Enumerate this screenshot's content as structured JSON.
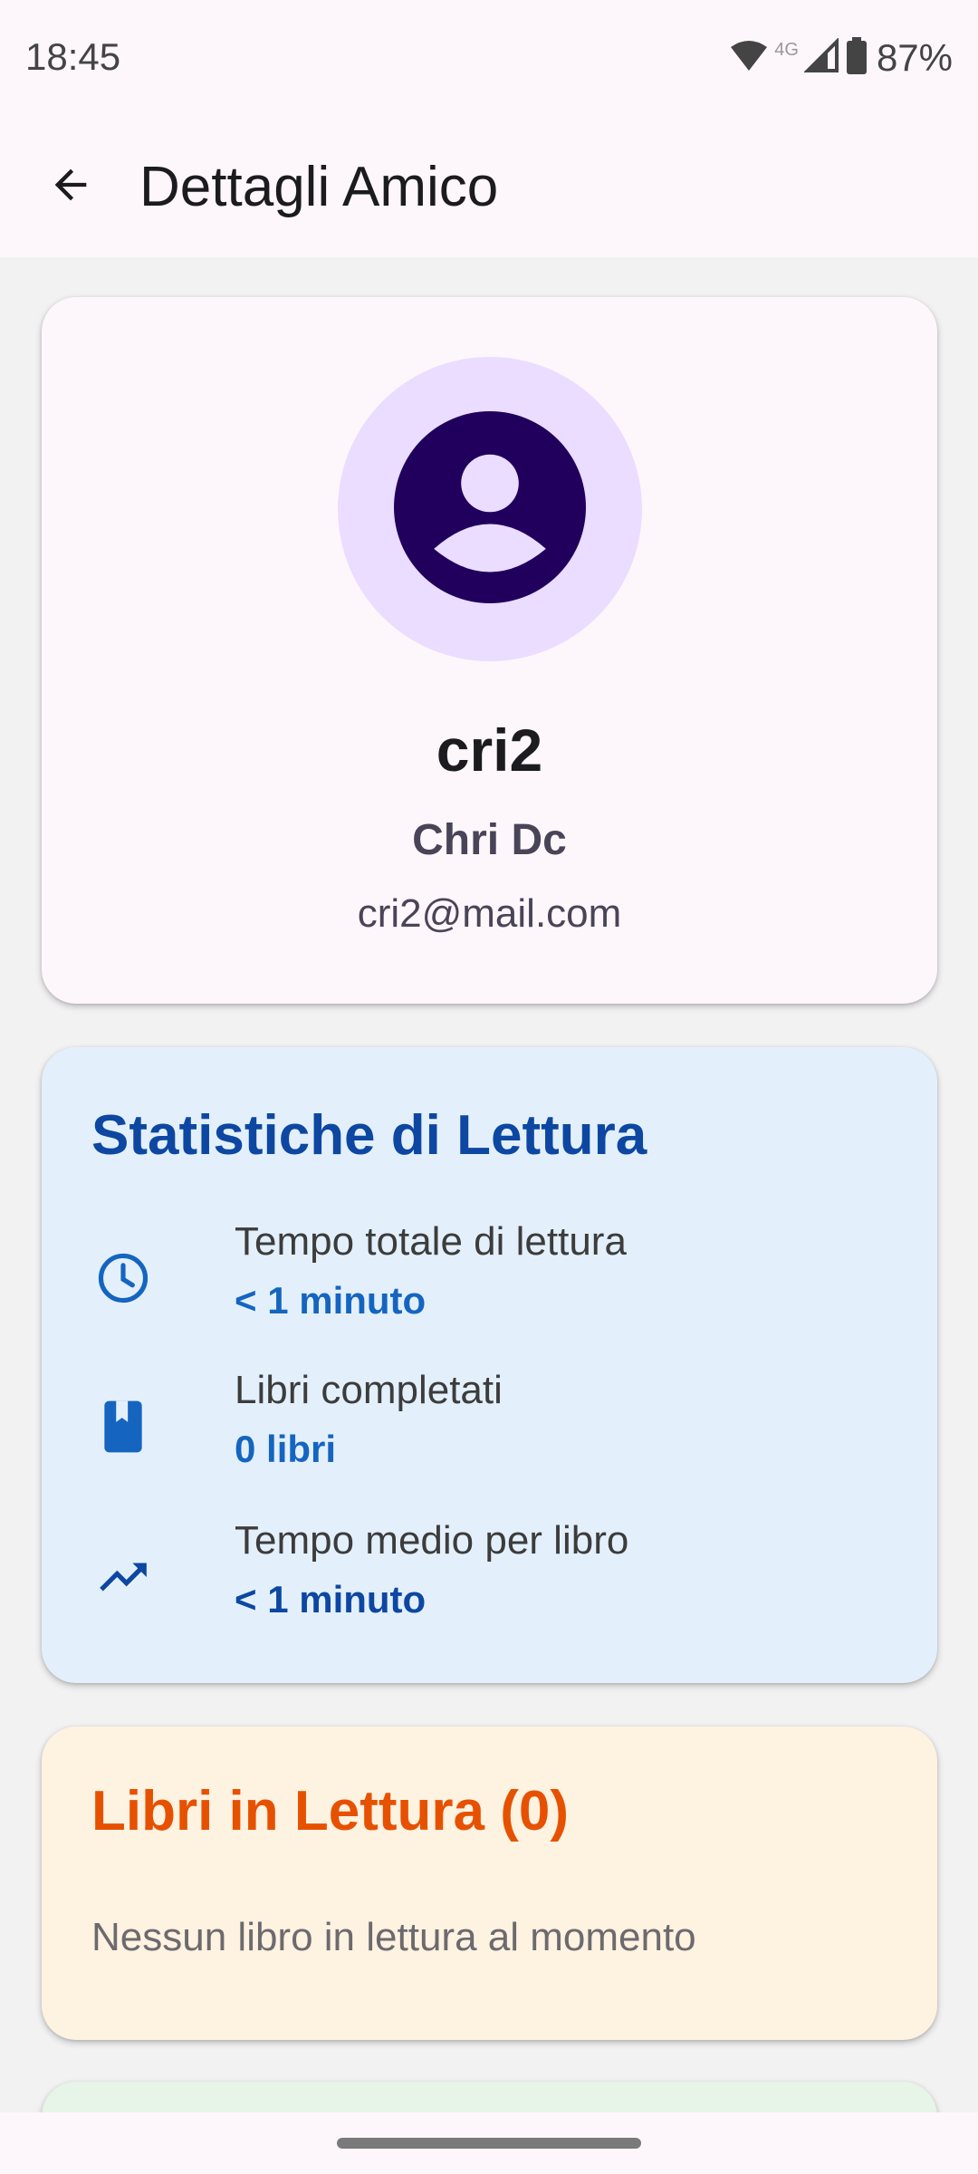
{
  "status_bar": {
    "time": "18:45",
    "network": "4G",
    "battery": "87%",
    "icons": [
      "wifi-icon",
      "signal-icon",
      "battery-icon"
    ]
  },
  "top_bar": {
    "back_icon": "arrow-back-icon",
    "title": "Dettagli Amico"
  },
  "profile": {
    "avatar_icon": "account-circle-icon",
    "username": "cri2",
    "full_name": "Chri Dc",
    "email": "cri2@mail.com"
  },
  "stats": {
    "title": "Statistiche di Lettura",
    "items": [
      {
        "icon": "clock-icon",
        "label": "Tempo totale di lettura",
        "value": "< 1 minuto",
        "value_color": "#1565C0"
      },
      {
        "icon": "book-icon",
        "label": "Libri completati",
        "value": "0 libri",
        "value_color": "#1565C0"
      },
      {
        "icon": "trending-up-icon",
        "label": "Tempo medio per libro",
        "value": "< 1 minuto",
        "value_color": "#0D47A1"
      }
    ]
  },
  "reading": {
    "title": "Libri in Lettura (0)",
    "empty_message": "Nessun libro in lettura al momento"
  },
  "colors": {
    "stats_accent": "#0D47A1",
    "reading_accent": "#E65100",
    "avatar_bg": "#EADDFF",
    "avatar_fg": "#21005D"
  }
}
